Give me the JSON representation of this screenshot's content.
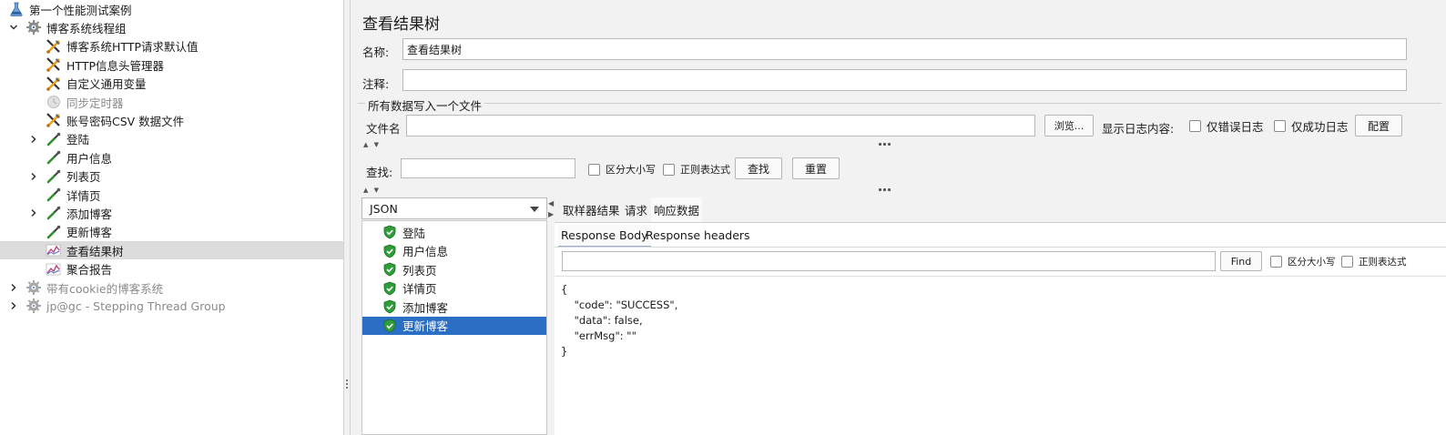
{
  "tree": {
    "items": [
      {
        "label": "第一个性能测试案例",
        "icon": "flask-icon",
        "expand": "none",
        "disabled": false,
        "selected": false
      },
      {
        "label": "博客系统线程组",
        "icon": "gear-icon",
        "expand": "expanded",
        "disabled": false,
        "selected": false
      },
      {
        "label": "博客系统HTTP请求默认值",
        "icon": "scissors-icon",
        "expand": "none",
        "disabled": false,
        "selected": false
      },
      {
        "label": "HTTP信息头管理器",
        "icon": "scissors-icon",
        "expand": "none",
        "disabled": false,
        "selected": false
      },
      {
        "label": "自定义通用变量",
        "icon": "scissors-icon",
        "expand": "none",
        "disabled": false,
        "selected": false
      },
      {
        "label": "同步定时器",
        "icon": "timer-icon",
        "expand": "none",
        "disabled": true,
        "selected": false
      },
      {
        "label": "账号密码CSV 数据文件",
        "icon": "scissors-icon",
        "expand": "none",
        "disabled": false,
        "selected": false
      },
      {
        "label": "登陆",
        "icon": "pipette-icon",
        "expand": "collapsed",
        "disabled": false,
        "selected": false
      },
      {
        "label": "用户信息",
        "icon": "pipette-icon",
        "expand": "none",
        "disabled": false,
        "selected": false
      },
      {
        "label": "列表页",
        "icon": "pipette-icon",
        "expand": "collapsed",
        "disabled": false,
        "selected": false
      },
      {
        "label": "详情页",
        "icon": "pipette-icon",
        "expand": "none",
        "disabled": false,
        "selected": false
      },
      {
        "label": "添加博客",
        "icon": "pipette-icon",
        "expand": "collapsed",
        "disabled": false,
        "selected": false
      },
      {
        "label": "更新博客",
        "icon": "pipette-icon",
        "expand": "none",
        "disabled": false,
        "selected": false
      },
      {
        "label": "查看结果树",
        "icon": "graph-icon",
        "expand": "none",
        "disabled": false,
        "selected": true
      },
      {
        "label": "聚合报告",
        "icon": "graph-icon",
        "expand": "none",
        "disabled": false,
        "selected": false
      },
      {
        "label": "带有cookie的博客系统",
        "icon": "gear-icon",
        "expand": "collapsed",
        "disabled": true,
        "selected": false
      },
      {
        "label": "jp@gc - Stepping Thread Group",
        "icon": "gear-icon",
        "expand": "collapsed",
        "disabled": true,
        "selected": false
      }
    ]
  },
  "panel": {
    "title": "查看结果树",
    "name_label": "名称:",
    "name_value": "查看结果树",
    "comment_label": "注释:",
    "comment_value": "",
    "file_group_title": "所有数据写入一个文件",
    "filename_label": "文件名",
    "filename_value": "",
    "browse_label": "浏览...",
    "log_content_label": "显示日志内容:",
    "errors_only_label": "仅错误日志",
    "success_only_label": "仅成功日志",
    "configure_label": "配置",
    "search_label": "查找:",
    "search_value": "",
    "case_sensitive_label": "区分大小写",
    "regex_label": "正则表达式",
    "find_label": "查找",
    "reset_label": "重置"
  },
  "renderer": {
    "selected": "JSON"
  },
  "samples": [
    {
      "label": "登陆",
      "status": "success",
      "selected": false
    },
    {
      "label": "用户信息",
      "status": "success",
      "selected": false
    },
    {
      "label": "列表页",
      "status": "success",
      "selected": false
    },
    {
      "label": "详情页",
      "status": "success",
      "selected": false
    },
    {
      "label": "添加博客",
      "status": "success",
      "selected": false
    },
    {
      "label": "更新博客",
      "status": "success",
      "selected": true
    }
  ],
  "detail": {
    "tabs": [
      "取样器结果",
      "请求",
      "响应数据"
    ],
    "active_tab": 2,
    "subtabs": [
      "Response Body",
      "Response headers"
    ],
    "active_subtab": 0,
    "find_value": "",
    "find_label": "Find",
    "case_sensitive_label": "区分大小写",
    "regex_label": "正则表达式",
    "response_lines": [
      "{",
      "    \"code\": \"SUCCESS\",",
      "    \"data\": false,",
      "    \"errMsg\": \"\"",
      "}"
    ]
  },
  "colors": {
    "selection_blue": "#2a6fc4",
    "tree_selected": "#dcdcdc",
    "success_green": "#2f9e3a"
  }
}
